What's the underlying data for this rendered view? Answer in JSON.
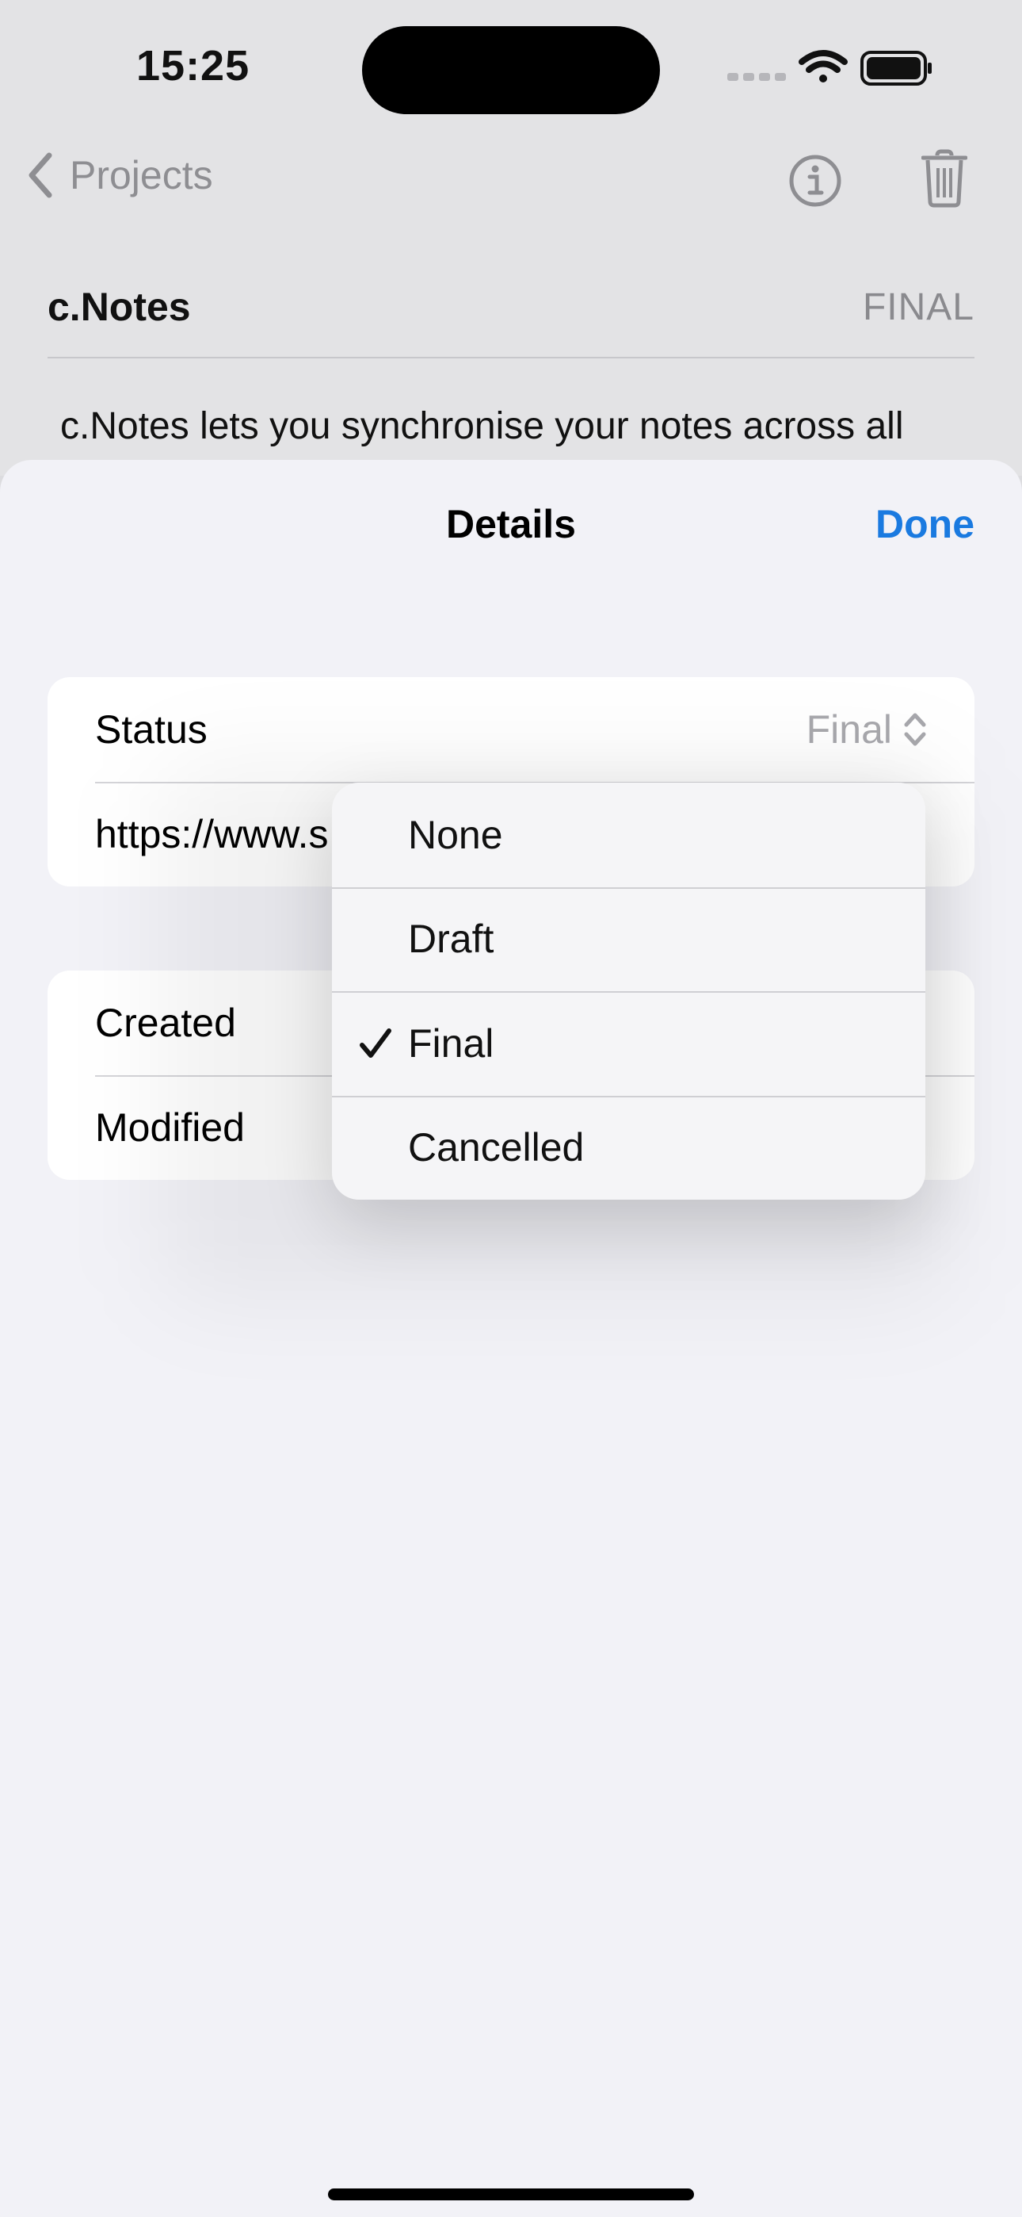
{
  "status_bar": {
    "time": "15:25"
  },
  "nav": {
    "back_label": "Projects"
  },
  "project": {
    "title": "c.Notes",
    "status": "FINAL",
    "description": "c.Notes lets you synchronise your notes across all"
  },
  "sheet": {
    "title": "Details",
    "done_label": "Done",
    "status_row": {
      "label": "Status",
      "value": "Final"
    },
    "url_row": {
      "value": "https://www.s"
    },
    "created_row": {
      "label": "Created"
    },
    "modified_row": {
      "label": "Modified"
    }
  },
  "status_menu": {
    "selected": "Final",
    "options": [
      "None",
      "Draft",
      "Final",
      "Cancelled"
    ]
  },
  "colors": {
    "accent": "#1a7ae0",
    "sheet_background": "#f2f2f7",
    "secondary_text": "#a8a8ad"
  }
}
